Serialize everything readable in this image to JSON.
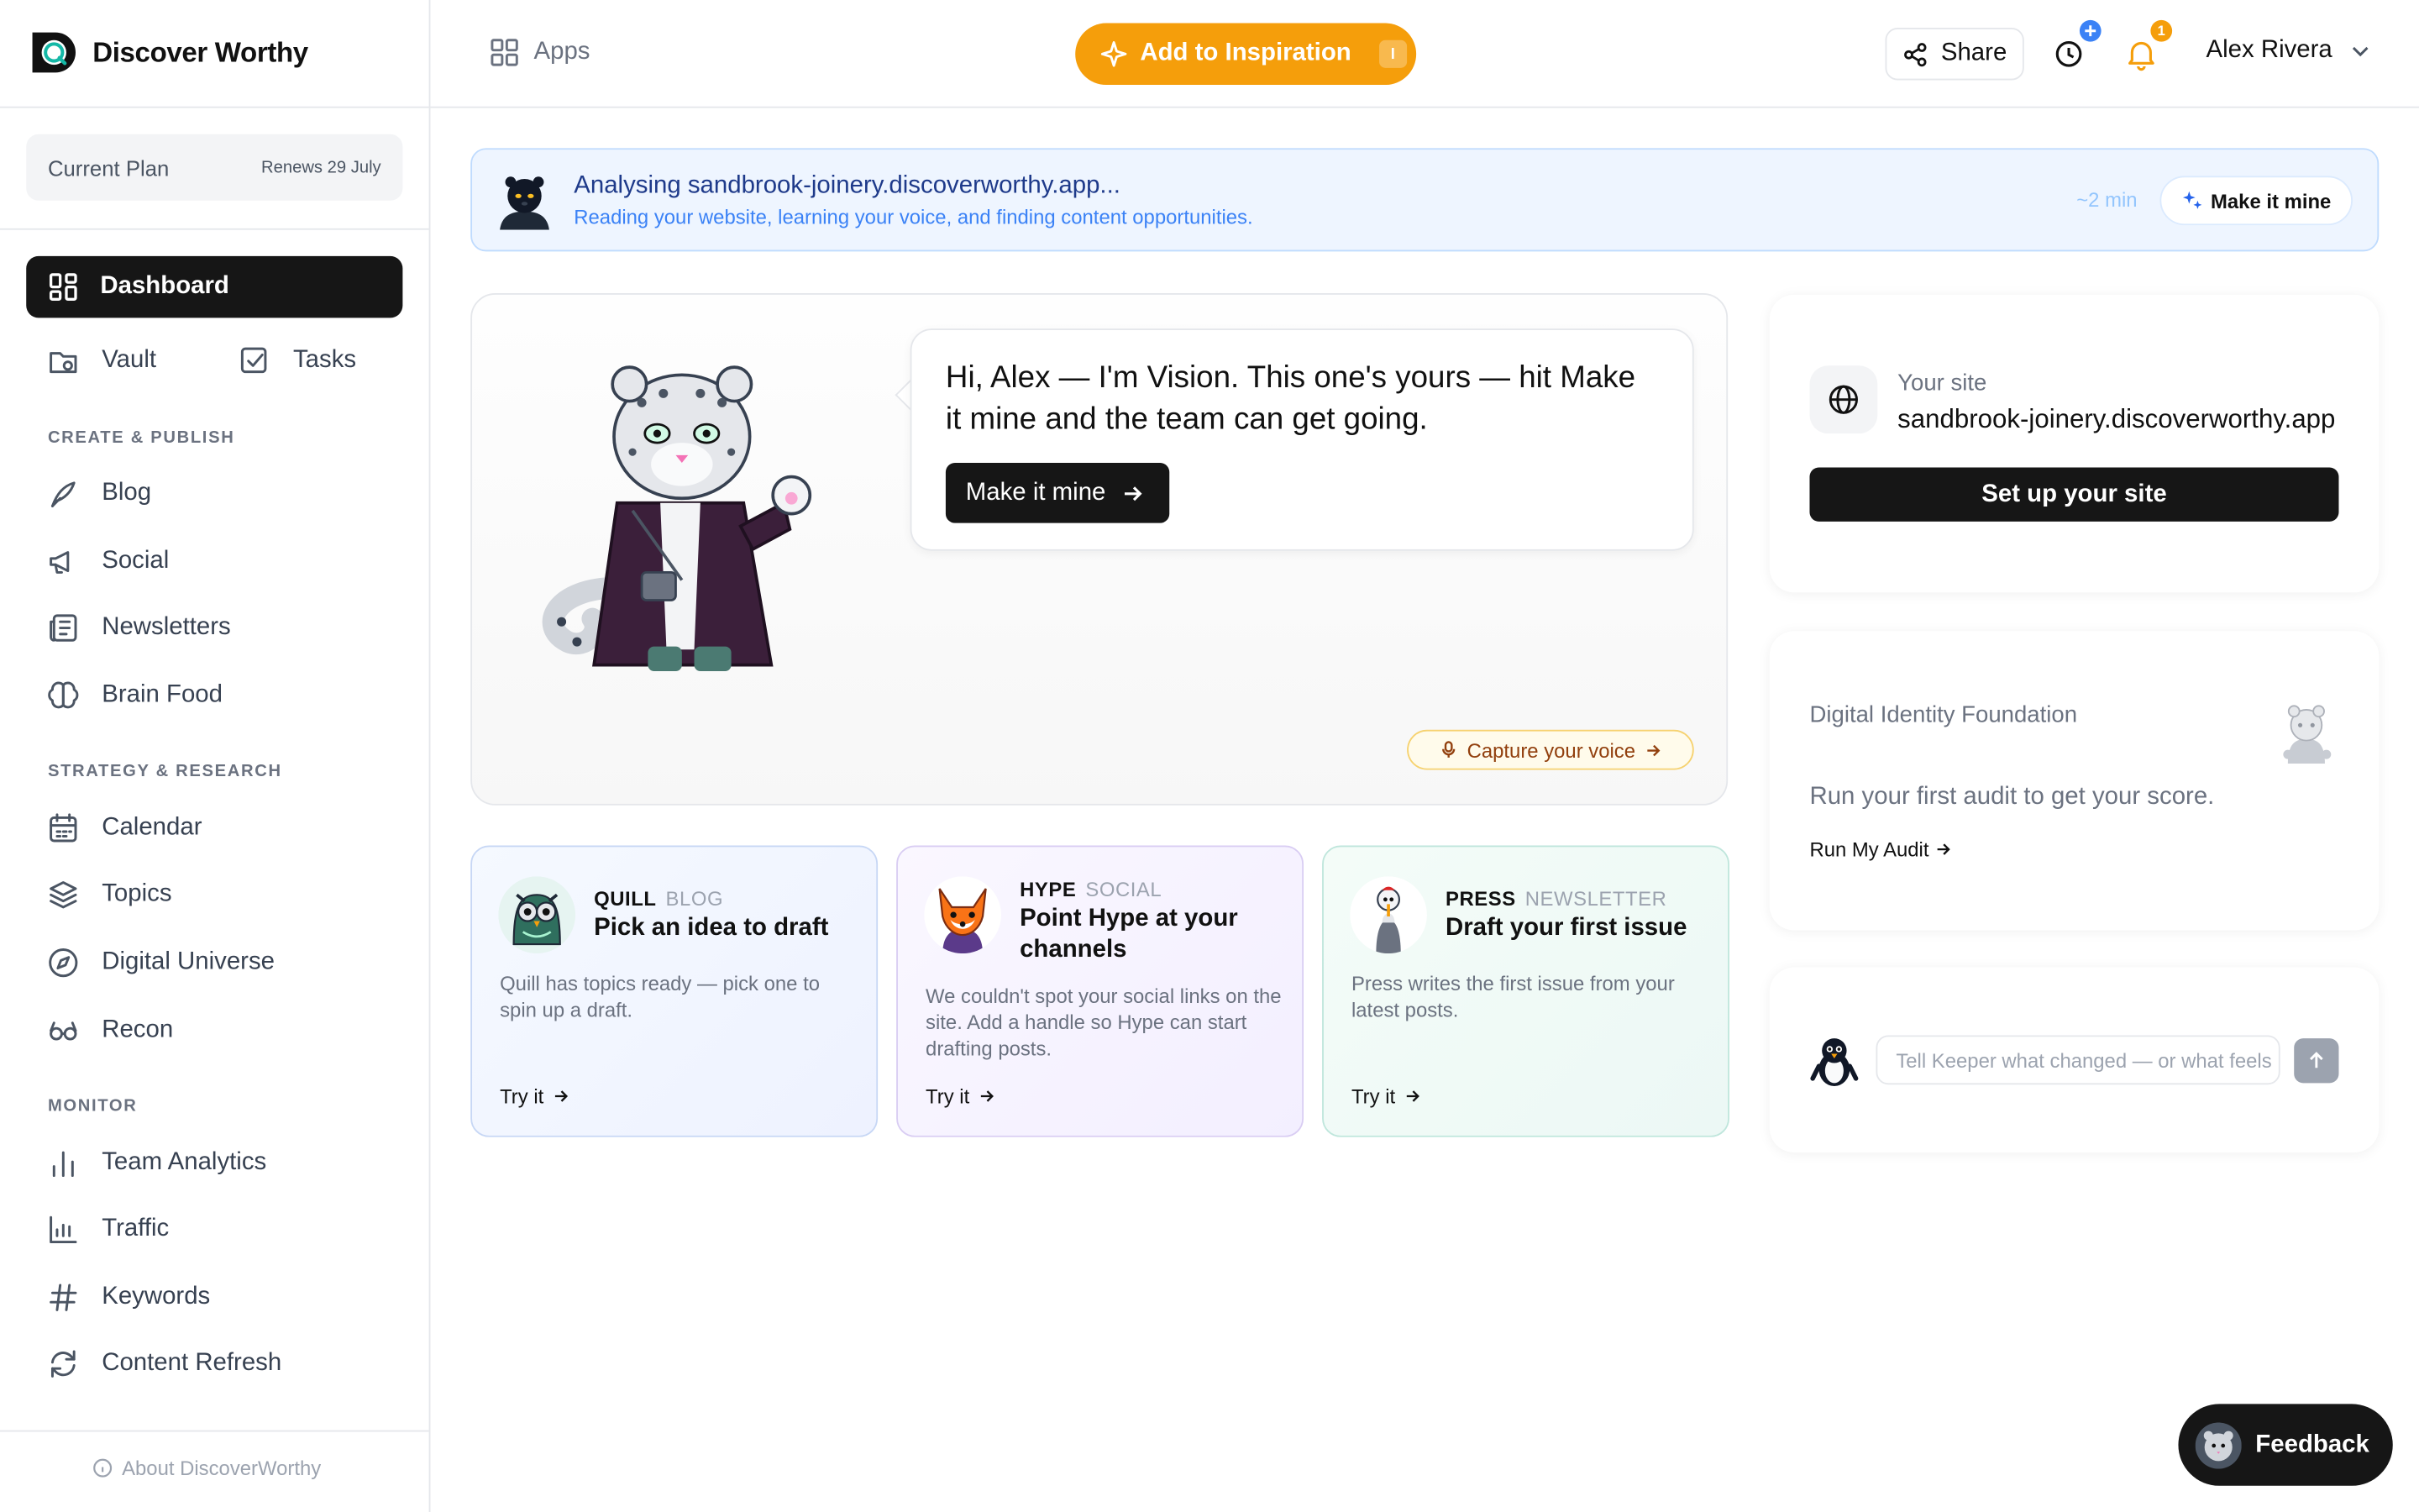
{
  "app": {
    "name": "Discover Worthy"
  },
  "sidebar": {
    "plan_label": "Current Plan",
    "plan_renews": "Renews 29 July",
    "dashboard": "Dashboard",
    "vault": "Vault",
    "tasks": "Tasks",
    "sections": [
      {
        "heading": "CREATE & PUBLISH",
        "items": [
          "Blog",
          "Social",
          "Newsletters",
          "Brain Food"
        ]
      },
      {
        "heading": "STRATEGY & RESEARCH",
        "items": [
          "Calendar",
          "Topics",
          "Digital Universe",
          "Recon"
        ]
      },
      {
        "heading": "MONITOR",
        "items": [
          "Team Analytics",
          "Traffic",
          "Keywords",
          "Content Refresh"
        ]
      }
    ],
    "about": "About DiscoverWorthy"
  },
  "header": {
    "apps": "Apps",
    "add_inspiration": "Add to Inspiration",
    "shortcut": "I",
    "share": "Share",
    "history_badge": "",
    "notif_badge": "1",
    "user_name": "Alex Rivera",
    "accent": "#f59e0b"
  },
  "banner": {
    "title": "Analysing sandbrook-joinery.discoverworthy.app...",
    "subtitle": "Reading your website, learning your voice, and finding content opportunities.",
    "eta": "~2 min",
    "button": "Make it mine"
  },
  "hero": {
    "message": "Hi, Alex — I'm Vision. This one's yours — hit Make it mine and the team can get going.",
    "button": "Make it mine",
    "voice_button": "Capture your voice"
  },
  "agents": [
    {
      "name": "QUILL",
      "category": "BLOG",
      "title": "Pick an idea to draft",
      "desc": "Quill has topics ready — pick one to spin up a draft.",
      "cta": "Try it"
    },
    {
      "name": "HYPE",
      "category": "SOCIAL",
      "title": "Point Hype at your channels",
      "desc": "We couldn't spot your social links on the site. Add a handle so Hype can start drafting posts.",
      "cta": "Try it"
    },
    {
      "name": "PRESS",
      "category": "NEWSLETTER",
      "title": "Draft your first issue",
      "desc": "Press writes the first issue from your latest posts.",
      "cta": "Try it"
    }
  ],
  "site": {
    "label": "Your site",
    "url": "sandbrook-joinery.discoverworthy.app",
    "button": "Set up your site"
  },
  "identity": {
    "title": "Digital Identity Foundation",
    "desc": "Run your first audit to get your score.",
    "link": "Run My Audit"
  },
  "keeper": {
    "placeholder": "Tell Keeper what changed — or what feels off",
    "value": ""
  },
  "feedback": {
    "label": "Feedback"
  },
  "icons": [
    "logo-icon",
    "plan-icon",
    "dashboard-icon",
    "vault-icon",
    "tasks-icon",
    "blog-icon",
    "social-icon",
    "newsletter-icon",
    "brain-icon",
    "calendar-icon",
    "topics-icon",
    "universe-icon",
    "recon-icon",
    "analytics-icon",
    "traffic-icon",
    "hash-icon",
    "refresh-icon",
    "info-icon",
    "apps-icon",
    "sparkle-icon",
    "share-icon",
    "clock-icon",
    "bell-icon",
    "chevron-down-icon",
    "globe-icon",
    "arrow-right-icon",
    "mic-icon",
    "arrow-up-icon"
  ]
}
